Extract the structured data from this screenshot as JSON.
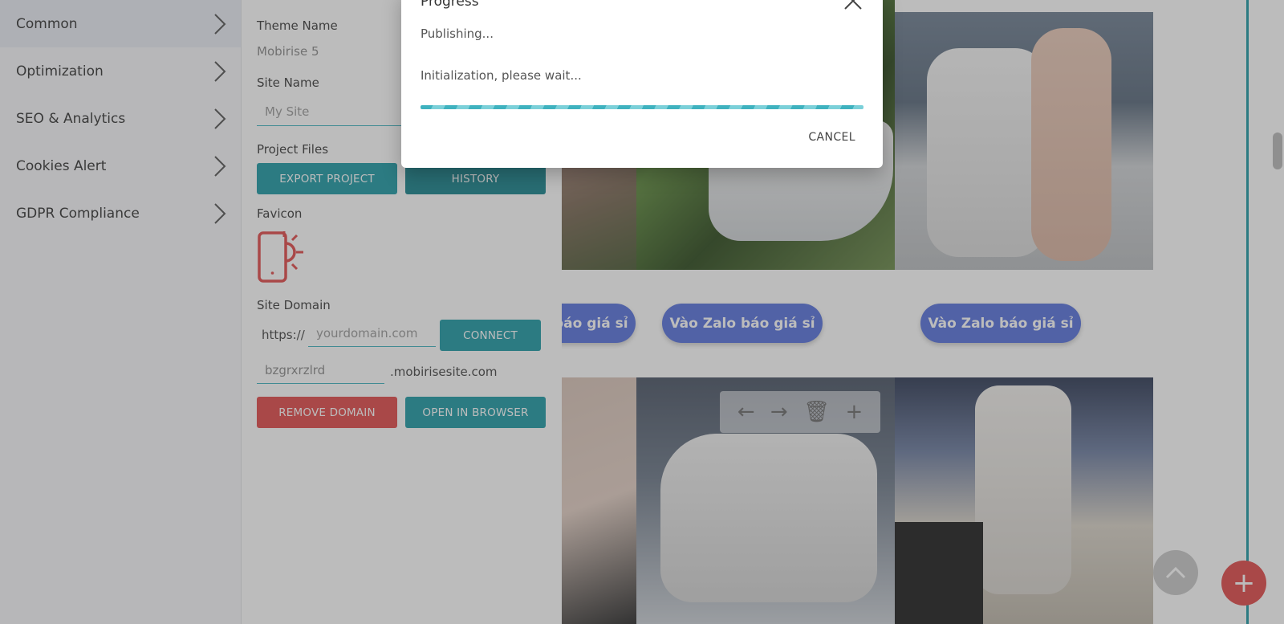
{
  "sidebar": {
    "items": [
      {
        "label": "Common"
      },
      {
        "label": "Optimization"
      },
      {
        "label": "SEO & Analytics"
      },
      {
        "label": "Cookies Alert"
      },
      {
        "label": "GDPR Compliance"
      }
    ]
  },
  "panel": {
    "theme_name_label": "Theme Name",
    "theme_name_value": "Mobirise 5",
    "site_name_label": "Site Name",
    "site_name_placeholder": "My Site",
    "project_files_label": "Project Files",
    "export_button": "EXPORT PROJECT",
    "history_button": "HISTORY",
    "favicon_label": "Favicon",
    "site_domain_label": "Site Domain",
    "protocol": "https://",
    "domain_placeholder": "yourdomain.com",
    "connect_button": "CONNECT",
    "subdomain_value": "bzgrxrzlrd",
    "subdomain_suffix": ".mobirisesite.com",
    "remove_domain_button": "REMOVE DOMAIN",
    "open_browser_button": "OPEN IN BROWSER"
  },
  "preview": {
    "cta_label": "Vào Zalo báo giá sỉ"
  },
  "modal": {
    "title": "Progress",
    "message1": "Publishing...",
    "message2": "Initialization, please wait...",
    "cancel_label": "CANCEL"
  },
  "colors": {
    "accent": "#1e9aa5",
    "danger": "#e24a4a",
    "cta": "#5872dd"
  }
}
